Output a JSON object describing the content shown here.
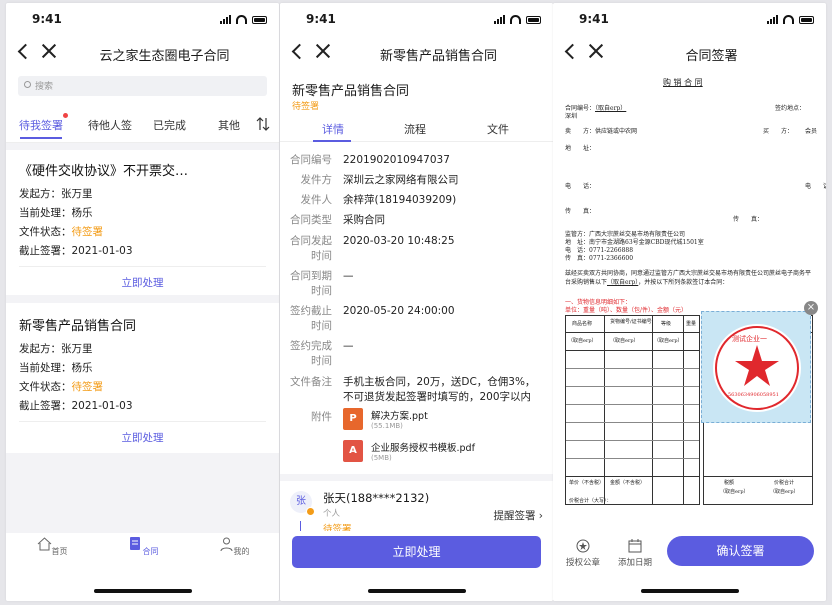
{
  "status_time": "9:41",
  "p1": {
    "nav_title": "云之家生态圈电子合同",
    "search_placeholder": "搜索",
    "tabs": [
      "待我签署",
      "待他人签",
      "已完成",
      "其他"
    ],
    "cards": [
      {
        "title": "《硬件交收协议》不开票交…",
        "rows": [
          [
            "发起方：",
            "张万里"
          ],
          [
            "当前处理：",
            "杨乐"
          ],
          [
            "文件状态：",
            "待签署"
          ],
          [
            "截止签署：",
            "2021-01-03"
          ]
        ],
        "action": "立即处理"
      },
      {
        "title": "新零售产品销售合同",
        "rows": [
          [
            "发起方：",
            "张万里"
          ],
          [
            "当前处理：",
            "杨乐"
          ],
          [
            "文件状态：",
            "待签署"
          ],
          [
            "截止签署：",
            "2021-01-03"
          ]
        ],
        "action": "立即处理"
      }
    ],
    "tabbar": [
      "首页",
      "合同",
      "我的"
    ]
  },
  "p2": {
    "nav_title": "新零售产品销售合同",
    "contract_title": "新零售产品销售合同",
    "badge": "待签署",
    "tabs": [
      "详情",
      "流程",
      "文件"
    ],
    "fields": [
      {
        "k": "合同编号",
        "v": "2201902010947037"
      },
      {
        "k": "发件方",
        "v": "深圳云之家网络有限公司"
      },
      {
        "k": "发件人",
        "v": "余梓萍(18194039209)"
      },
      {
        "k": "合同类型",
        "v": "采购合同"
      },
      {
        "k": "合同发起时间",
        "v": "2020-03-20 10:48:25"
      },
      {
        "k": "合同到期时间",
        "v": "—"
      },
      {
        "k": "签约截止时间",
        "v": "2020-05-20 24:00:00"
      },
      {
        "k": "签约完成时间",
        "v": "—"
      },
      {
        "k": "文件备注",
        "v": "手机主板合同，20万，送DC，仓佣3%，不可退货发起签署时填写的，200字以内"
      }
    ],
    "attach_label": "附件",
    "attachments": [
      {
        "name": "解决方案.ppt",
        "size": "(55.1MB)",
        "icon": "P"
      },
      {
        "name": "企业服务授权书模板.pdf",
        "size": "(5MB)",
        "icon": "A"
      }
    ],
    "signer_avatar": "张",
    "signer_name": "张天(188****2132)",
    "signer_type": "个人",
    "signer_status": "待签署",
    "remind": "提醒签署",
    "primary_button": "立即处理"
  },
  "p3": {
    "nav_title": "合同签署",
    "doc": {
      "heading": "购 销 合 同",
      "no": "合同编号：",
      "no_val": "（取自erp）",
      "place": "签约地点：",
      "place_val": "深圳",
      "seller": "卖　　方：",
      "seller_val": "供应链或中农网",
      "buyer": "买　　方：",
      "buyer_val": "会员",
      "addr": "地　　址：",
      "tel": "电　　话：",
      "fax": "传　　真：",
      "sup": "监管方：",
      "sup_val": "广西大宗蔗丝交易市场有限责任公司",
      "sup_addr": "地　址：南宁市金湖路63号金源CBD现代城1501室",
      "sup_tel": "电　话：0771-2266888",
      "sup_fax": "传　真：0771-2366600",
      "para": "兹经买卖双方共同协商，同意通过监管方广西大宗蔗丝交易市场有限责任公司蔗丝电子商务平台采购销售以下",
      "para2": "（取自erp）",
      "para3": "，并按以下所列条款签订本合同：",
      "s1": "一、货物信息明细如下：",
      "s1u": "单位：重量（吨）、数量（包/件）、金额（元）",
      "cols": [
        "商品名称",
        "货物编号/证书编号",
        "等级",
        "重量"
      ],
      "cell": "（取自erp）",
      "foot": [
        "单价（不含税）",
        "金额（不含税）",
        "税额",
        "价税合计"
      ],
      "total": "价税合计（大写）：",
      "stamp_text": "测试企业一",
      "stamp_no": "5630634906058951"
    },
    "actions": [
      "授权公章",
      "添加日期"
    ],
    "confirm": "确认签署"
  }
}
